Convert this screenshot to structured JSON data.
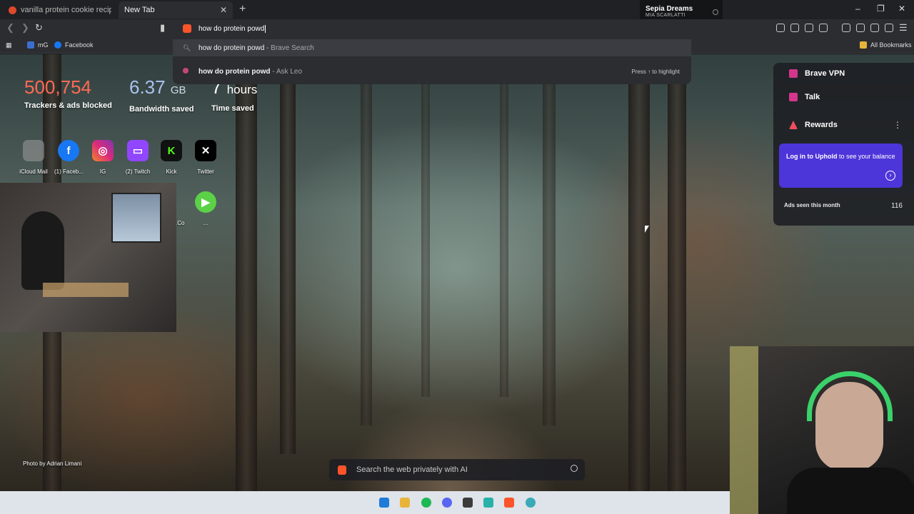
{
  "tabs": [
    {
      "title": "vanilla protein cookie recipes - Brave",
      "active": false
    },
    {
      "title": "New Tab",
      "active": true
    }
  ],
  "now_playing": {
    "title": "Sepia Dreams",
    "artist": "MIA SCARLATTI"
  },
  "address_bar": {
    "value": "how do protein powd"
  },
  "suggestions": [
    {
      "query": "how do protein powd",
      "source": "- Brave Search",
      "icon": "search-icon"
    },
    {
      "query": "how do protein powd",
      "source": "- Ask Leo",
      "icon": "leo-icon",
      "hint": "Press ↑ to highlight"
    }
  ],
  "bookmarks": {
    "items": [
      "mG",
      "Facebook"
    ],
    "all_bookmarks": "All Bookmarks"
  },
  "stats": {
    "trackers": {
      "value": "500,754",
      "label": "Trackers & ads blocked",
      "color": "#ff6a55"
    },
    "bandwidth": {
      "value": "6.37",
      "unit": "GB",
      "label": "Bandwidth saved",
      "color": "#a9c1ee"
    },
    "time": {
      "value": "7",
      "unit": "hours",
      "label": "Time saved"
    }
  },
  "top_sites": [
    {
      "label": "iCloud Mail",
      "icon": "icloud-icon",
      "color": "#8a8a8a"
    },
    {
      "label": "(1) Faceb...",
      "icon": "facebook-icon",
      "color": "#1877f2"
    },
    {
      "label": "IG",
      "icon": "instagram-icon",
      "color": "#d62976"
    },
    {
      "label": "(2) Twitch",
      "icon": "twitch-icon",
      "color": "#9146ff"
    },
    {
      "label": "Kick",
      "icon": "kick-icon",
      "color": "#53fc18"
    },
    {
      "label": "Twitter",
      "icon": "x-icon",
      "color": "#000000"
    }
  ],
  "top_sites_row2": [
    {
      "label": "...Co",
      "icon": "site-icon"
    },
    {
      "label": "...",
      "icon": "play-icon"
    }
  ],
  "widgets": {
    "vpn": "Brave VPN",
    "talk": "Talk",
    "rewards": "Rewards",
    "uphold_bold": "Log in to Uphold",
    "uphold_rest": " to see your balance",
    "ads_label": "Ads seen this month",
    "ads_count": "116"
  },
  "photo_credit": "Photo by Adrian Limani",
  "ai_search": {
    "placeholder": "Search the web privately with AI"
  }
}
